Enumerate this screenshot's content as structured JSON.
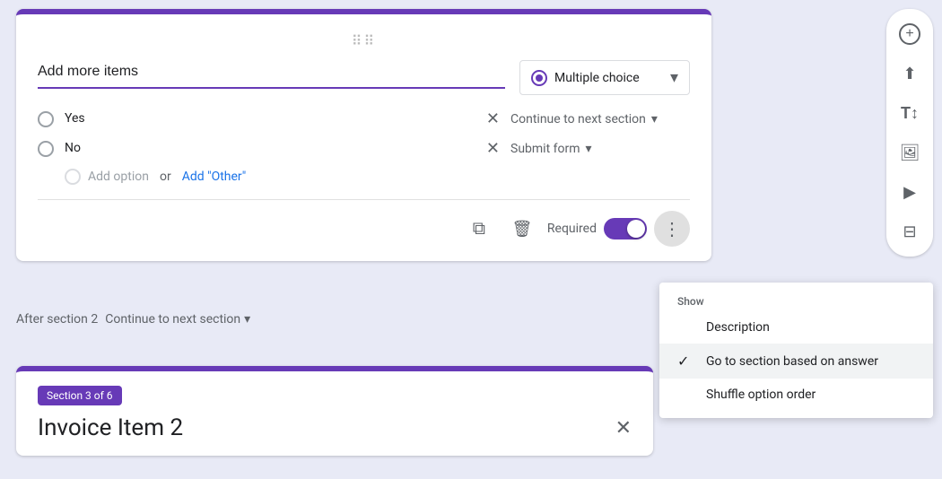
{
  "page": {
    "background": "#e8eaf6"
  },
  "drag_handle": "⠿",
  "question": {
    "placeholder": "Add more items",
    "type": "Multiple choice"
  },
  "options": [
    {
      "label": "Yes",
      "section": "Continue to next section"
    },
    {
      "label": "No",
      "section": "Submit form"
    }
  ],
  "add_option": {
    "text": "Add option",
    "or": "or",
    "add_other": "Add \"Other\""
  },
  "toolbar": {
    "required_label": "Required",
    "more_label": "⋮",
    "copy_icon": "⧉",
    "delete_icon": "🗑"
  },
  "section_bar": {
    "prefix": "After section 2",
    "value": "Continue to next section"
  },
  "section3": {
    "badge": "Section 3 of 6",
    "title": "Invoice Item 2"
  },
  "context_menu": {
    "header": "Show",
    "items": [
      {
        "label": "Description",
        "checked": false
      },
      {
        "label": "Go to section based on answer",
        "checked": true
      },
      {
        "label": "Shuffle option order",
        "checked": false
      }
    ]
  },
  "sidebar": {
    "icons": [
      {
        "name": "add-circle-icon",
        "symbol": "+"
      },
      {
        "name": "import-icon",
        "symbol": "⬆"
      },
      {
        "name": "text-icon",
        "symbol": "T"
      },
      {
        "name": "image-icon",
        "symbol": "🖼"
      },
      {
        "name": "video-icon",
        "symbol": "▶"
      },
      {
        "name": "section-icon",
        "symbol": "⊟"
      }
    ]
  }
}
